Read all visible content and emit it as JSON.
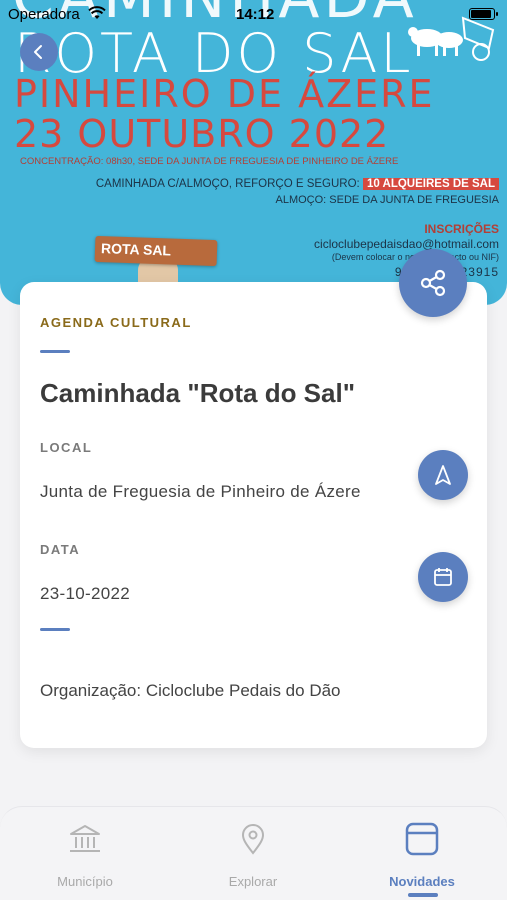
{
  "status_bar": {
    "carrier": "Operadora",
    "time": "14:12",
    "battery_level": 0.85
  },
  "poster": {
    "ghost_title": "CAMINHADA",
    "rota_title": "ROTA DO SAL",
    "location_line": "PINHEIRO DE ÁZERE",
    "date_line": "23 OUTUBRO 2022",
    "concentration": "CONCENTRAÇÃO: 08h30, SEDE DA JUNTA DE FREGUESIA DE PINHEIRO DE ÁZERE",
    "walk_text": "CAMINHADA C/ALMOÇO, REFORÇO E SEGURO:",
    "walk_price": "10 ALQUEIRES DE SAL",
    "lunch": "ALMOÇO: SEDE DA JUNTA DE FREGUESIA",
    "inscriptions": "INSCRIÇÕES",
    "email": "cicloclubepedaisdao@hotmail.com",
    "note": "(Devem colocar o nome, contacto ou NIF)",
    "phone": "96570310 23915",
    "sign": "ROTA SAL"
  },
  "card": {
    "category": "AGENDA CULTURAL",
    "title": "Caminhada \"Rota do Sal\"",
    "local_label": "LOCAL",
    "local_value": "Junta de Freguesia de Pinheiro de Ázere",
    "date_label": "DATA",
    "date_value": "23-10-2022",
    "organization": "Organização: Cicloclube Pedais do Dão"
  },
  "tabs": [
    {
      "label": "Município",
      "icon": "building-icon",
      "active": false
    },
    {
      "label": "Explorar",
      "icon": "location-pin-icon",
      "active": false
    },
    {
      "label": "Novidades",
      "icon": "news-icon",
      "active": true
    }
  ],
  "colors": {
    "accent": "#5b7fbf",
    "category": "#8a6a1a",
    "poster_bg": "#44b5d9",
    "poster_red": "#d6493f"
  }
}
